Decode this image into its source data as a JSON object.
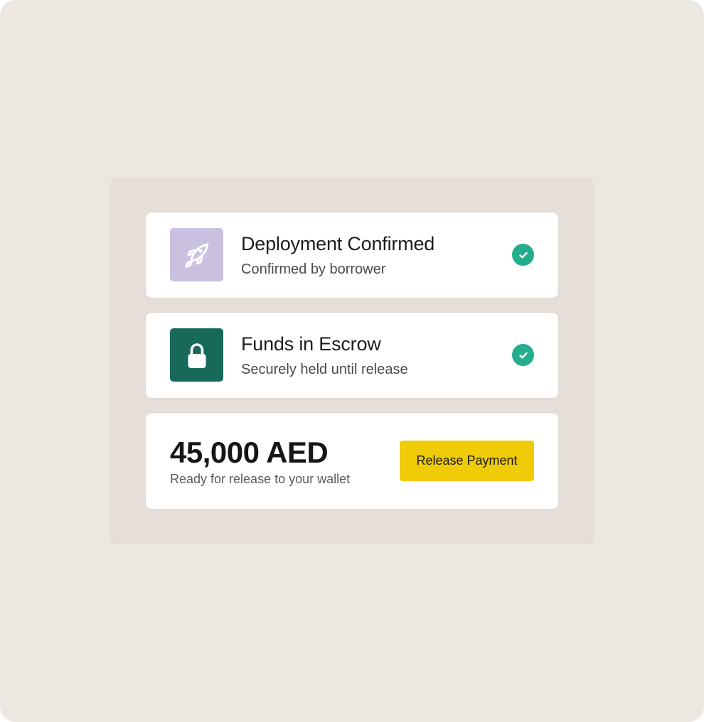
{
  "colors": {
    "page_background": "#ece7e1",
    "panel_background": "#e6dfd9",
    "card_background": "#ffffff",
    "deploy_icon_tile": "#cac0e0",
    "escrow_icon_tile": "#17695a",
    "check_green": "#23ad8d",
    "release_button": "#f0cb07"
  },
  "steps": [
    {
      "icon": "rocket-icon",
      "title": "Deployment Confirmed",
      "subtitle": "Confirmed by borrower",
      "status_icon": "check-circle-icon"
    },
    {
      "icon": "lock-icon",
      "title": "Funds in Escrow",
      "subtitle": "Securely held until release",
      "status_icon": "check-circle-icon"
    }
  ],
  "payment": {
    "amount": "45,000 AED",
    "note": "Ready for release to your wallet",
    "button_label": "Release Payment"
  }
}
